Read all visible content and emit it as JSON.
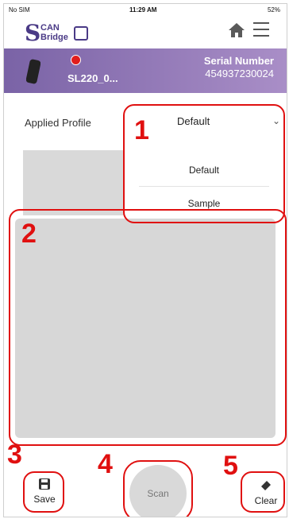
{
  "status_bar": {
    "carrier": "No SIM",
    "time": "11:29 AM",
    "battery": "52%"
  },
  "header": {
    "logo_initial": "S",
    "logo_top": "CAN",
    "logo_bottom": "Bridge"
  },
  "device": {
    "name": "SL220_0...",
    "serial_label": "Serial Number",
    "serial_value": "454937230024",
    "connection_color": "#e01d1d"
  },
  "profile": {
    "label": "Applied Profile",
    "selected": "Default",
    "options": [
      "Default",
      "Sample"
    ]
  },
  "annotations": [
    "1",
    "2",
    "3",
    "4",
    "5"
  ],
  "bottom": {
    "save_label": "Save",
    "scan_label": "Scan",
    "clear_label": "Clear"
  },
  "colors": {
    "accent": "#7a63a6",
    "annotation": "#e01010",
    "panel": "#d7d7d7"
  }
}
